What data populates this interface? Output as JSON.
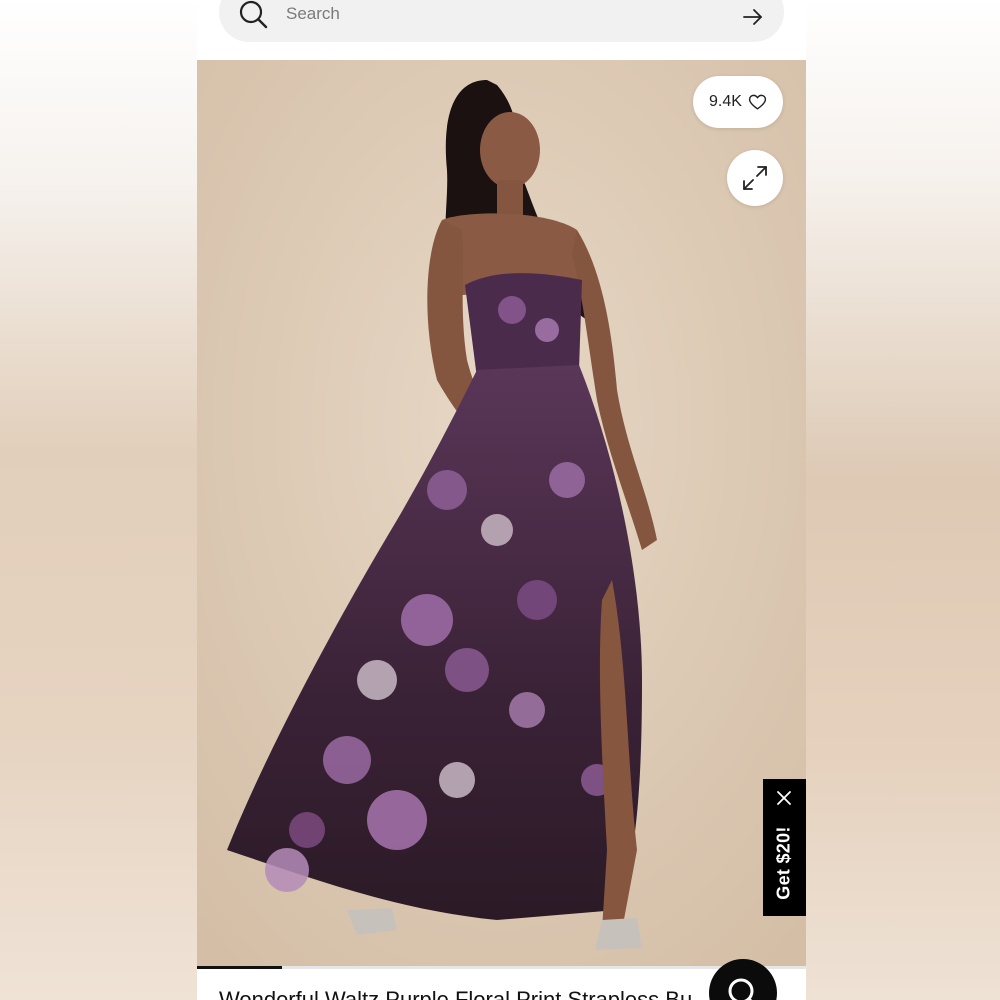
{
  "search": {
    "placeholder": "Search"
  },
  "product": {
    "likes": "9.4K",
    "title": "Wonderful Waltz Purple Floral Print Strapless Bu",
    "image_progress": 0.14
  },
  "promo": {
    "label": "Get $20!"
  },
  "colors": {
    "background": "#ffffff",
    "promo_bg": "#000000",
    "search_bg": "#f1f1f1",
    "dress_purple": "#4b2a4f",
    "backdrop": "#dcc8b1"
  },
  "icons": {
    "search": "magnifier",
    "submit": "arrow-right",
    "like": "heart-outline",
    "expand": "diagonal-expand-arrows",
    "close": "x",
    "chat": "magnifier"
  }
}
